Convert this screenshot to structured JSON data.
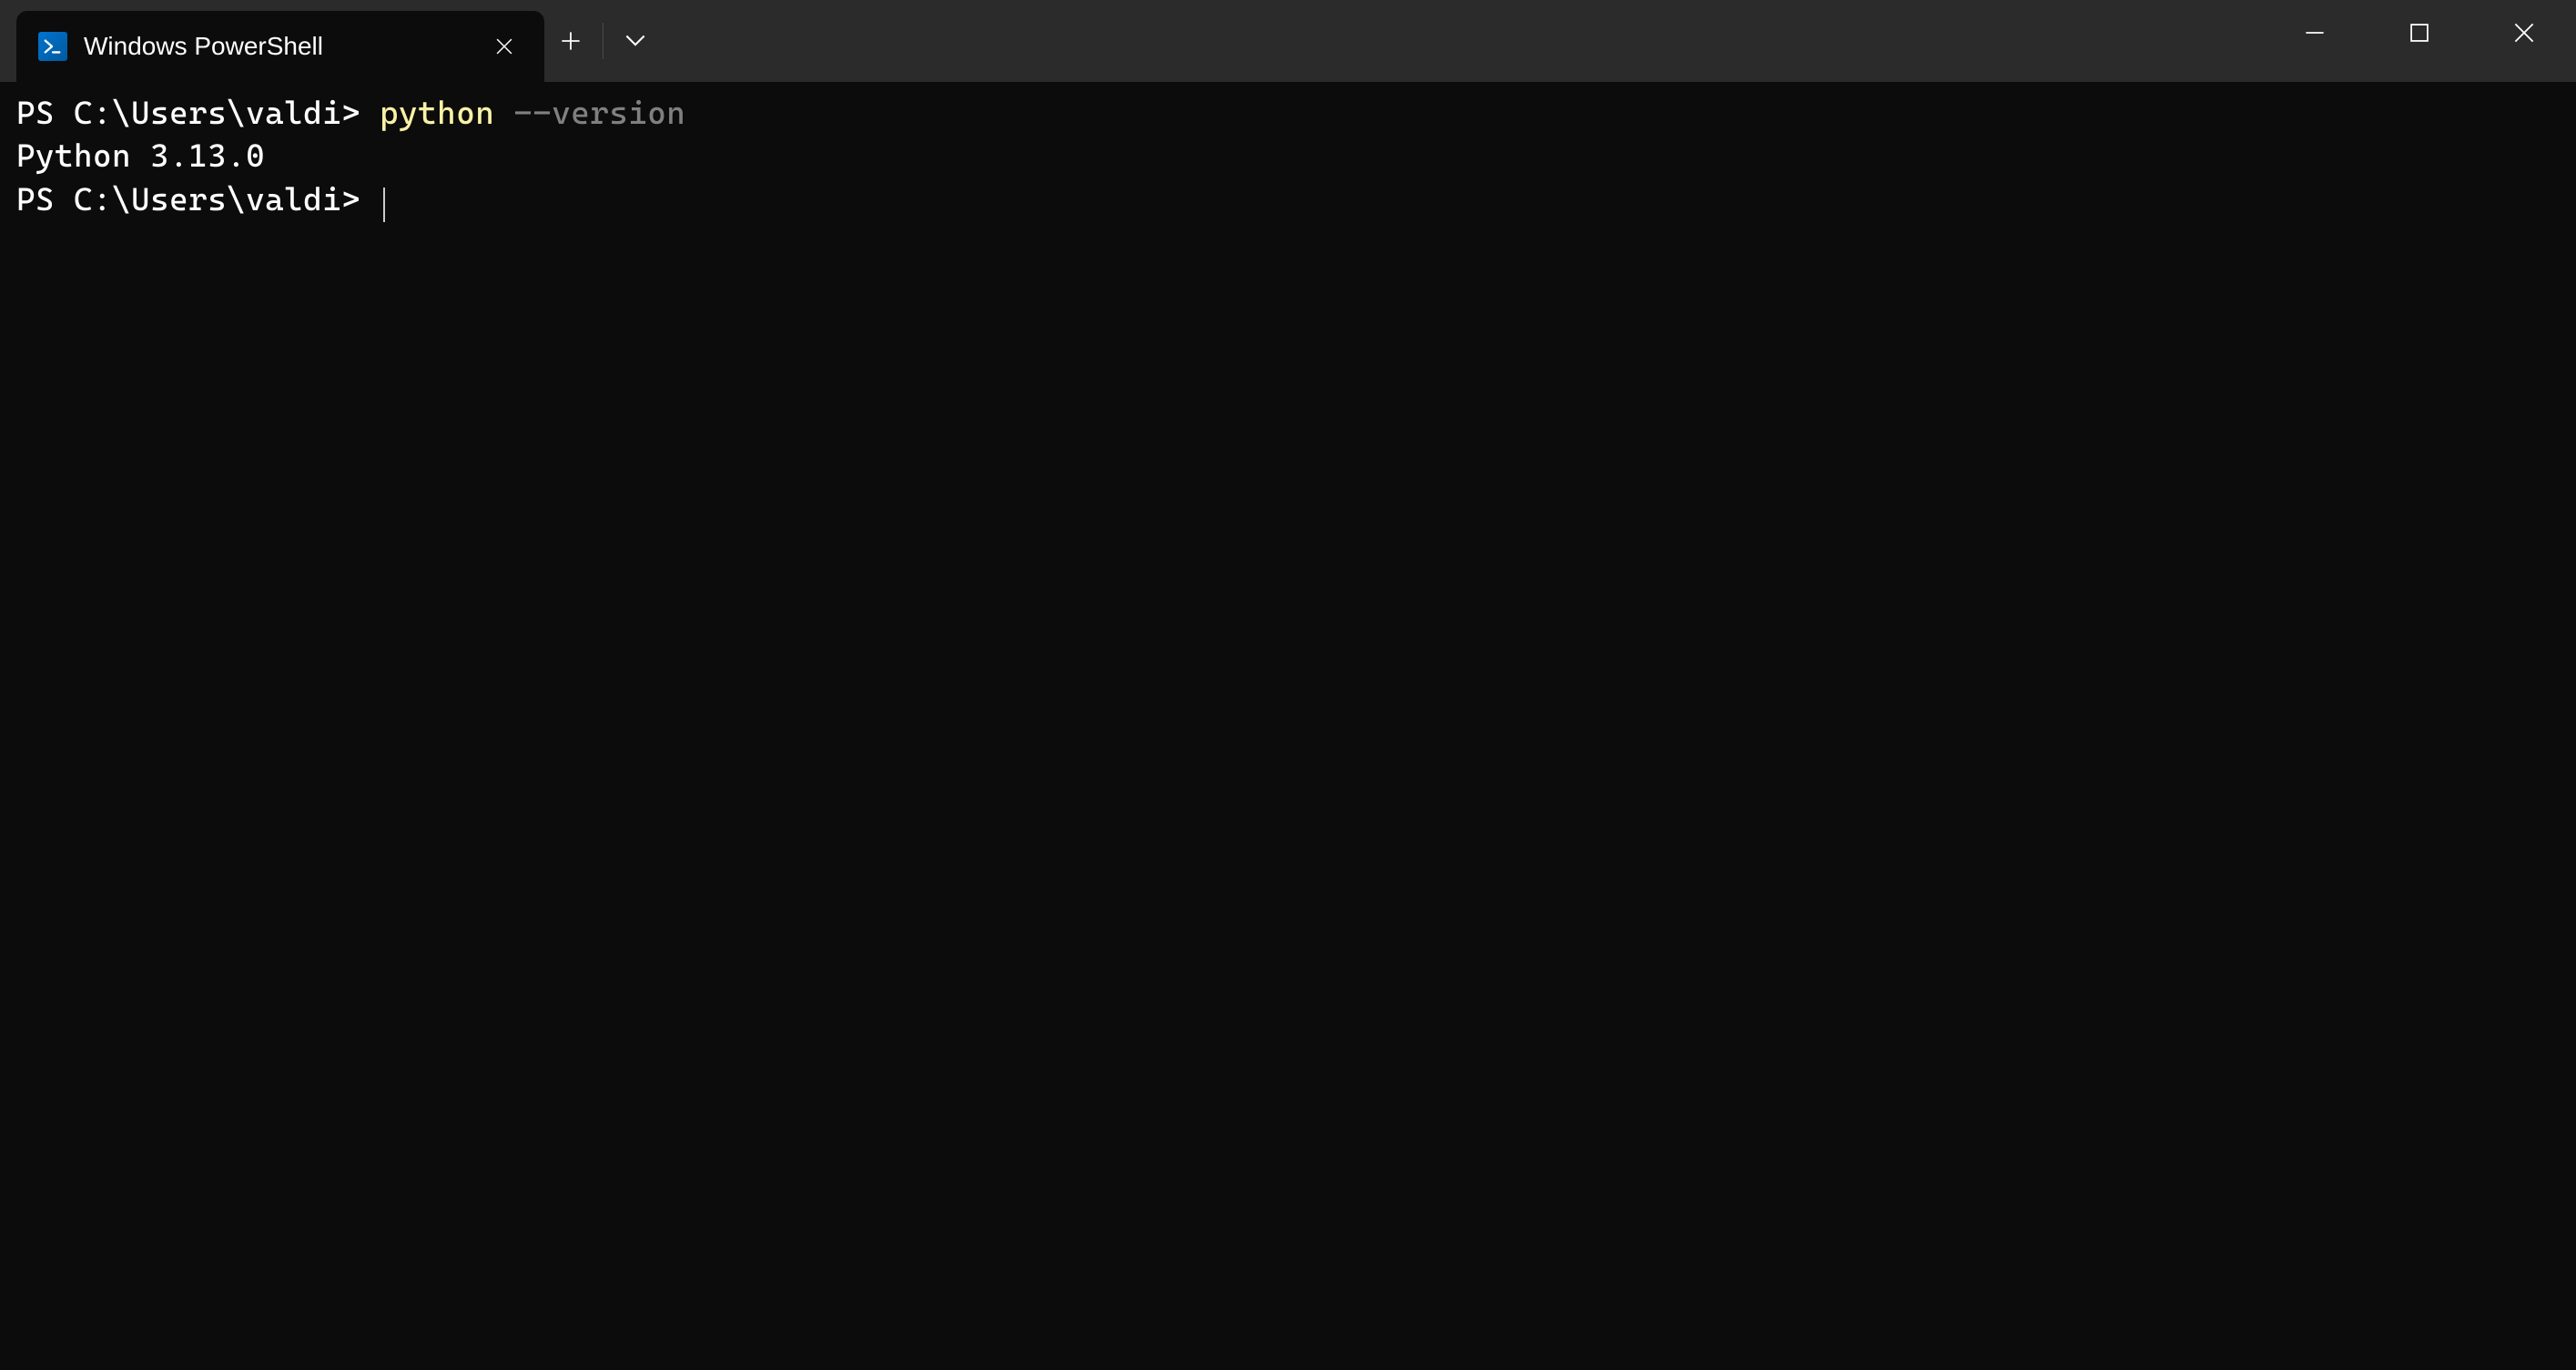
{
  "titlebar": {
    "tab_title": "Windows PowerShell"
  },
  "terminal": {
    "line1": {
      "prompt": "PS C:\\Users\\valdi> ",
      "command": "python ",
      "argument": "--version"
    },
    "line2": {
      "output": "Python 3.13.0"
    },
    "line3": {
      "prompt": "PS C:\\Users\\valdi> "
    }
  }
}
